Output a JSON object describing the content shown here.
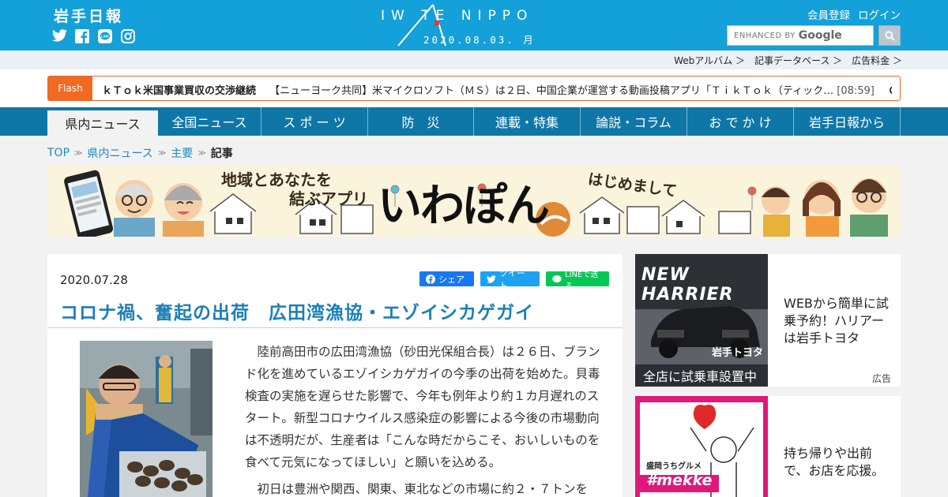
{
  "header": {
    "logo_jp": "岩手日報",
    "brand": "IW TE NIPPO",
    "date": "2020.08.03. 月",
    "member_register": "会員登録",
    "login": "ログイン",
    "search_placeholder": "ENHANCED BY",
    "search_brand": "Google",
    "social_icons": [
      "twitter-icon",
      "facebook-icon",
      "line-icon",
      "instagram-icon"
    ]
  },
  "subnav": {
    "links": [
      "Webアルバム ＞",
      "記事データベース ＞",
      "広告料金 ＞"
    ]
  },
  "flash": {
    "label": "Flash",
    "prefix": "ｋＴｏｋ米国事業買収の交渉継続",
    "text": "【ニューヨーク共同】米マイクロソフト（ＭＳ）は２日、中国企業が運営する動画投稿アプリ「ＴｉｋＴｏｋ（ティック…",
    "time": "[08:59]",
    "next": "ＧＤ"
  },
  "nav": {
    "items": [
      "県内ニュース",
      "全国ニュース",
      "ス ポ ー ツ",
      "防　災",
      "連載・特集",
      "論説・コラム",
      "お で か け",
      "岩手日報から"
    ]
  },
  "breadcrumb": {
    "top": "TOP",
    "section": "県内ニュース",
    "sub": "主要",
    "current": "記事"
  },
  "banner": {
    "line1": "地域とあなたを",
    "line2": "結ぶアプリ",
    "app_name": "いわぽん",
    "greeting": "はじめまして"
  },
  "article": {
    "date": "2020.07.28",
    "share_fb": "シェア",
    "share_tw": "ツイート",
    "share_line": "LINEで送る",
    "title": "コロナ禍、奮起の出荷　広田湾漁協・エゾイシカゲガイ",
    "paragraphs": [
      "陸前高田市の広田湾漁協（砂田光保組合長）は２６日、ブランド化を進めているエゾイシカゲガイの今季の出荷を始めた。貝毒検査の実施を遅らせた影響で、今年も例年より約１カ月遅れのスタート。新型コロナウイルス感染症の影響による今後の市場動向は不透明だが、生産者は「こんな時だからこそ、おいしいものを食べて元気になってほしい」と願いを込める。",
      "初日は豊洲や関西、関東、東北などの市場に約２・７トンを"
    ]
  },
  "ads": [
    {
      "img_title": "NEW HARRIER",
      "img_brand": "岩手トヨタ",
      "img_caption": "全店に試乗車設置中",
      "text": "WEBから簡単に試乗予約！ハリアーは岩手トヨタ",
      "label": "広告"
    },
    {
      "img_sub": "盛岡うちグルメ",
      "img_title": "#mekke",
      "text": "持ち帰りや出前で、お店を応援。"
    }
  ],
  "colors": {
    "header_blue": "#14a0d8",
    "nav_blue": "#0f77a7",
    "flash_orange": "#f06a22",
    "title_blue": "#1a7fb8"
  }
}
